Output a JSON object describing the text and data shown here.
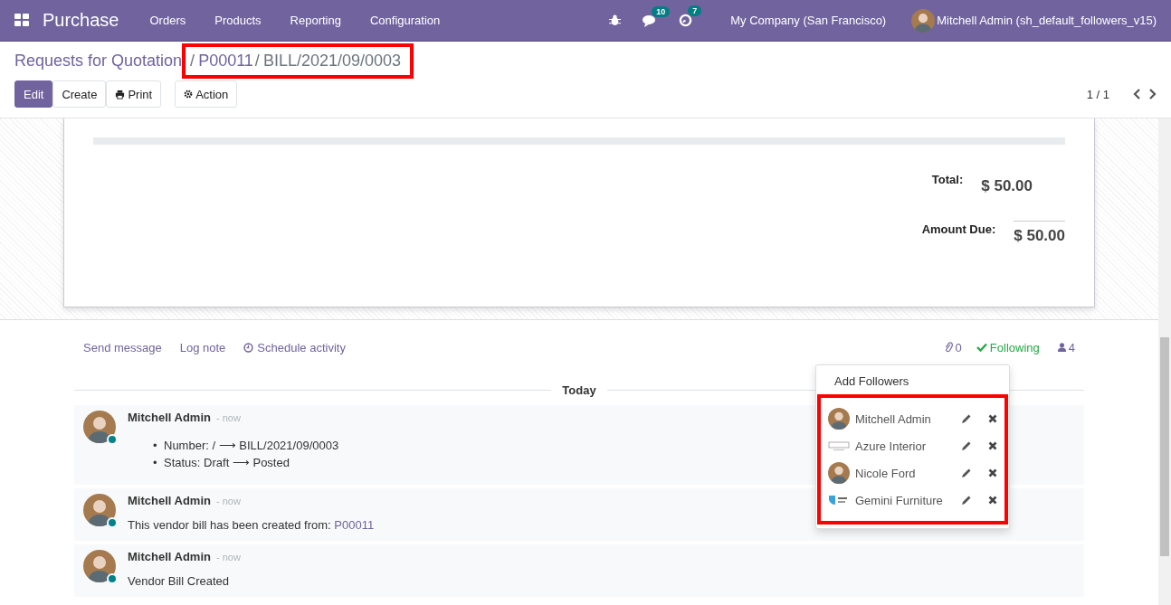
{
  "navbar": {
    "app": "Purchase",
    "menu": [
      "Orders",
      "Products",
      "Reporting",
      "Configuration"
    ],
    "messages_badge": "10",
    "activities_badge": "7",
    "company": "My Company (San Francisco)",
    "user": "Mitchell Admin (sh_default_followers_v15)"
  },
  "breadcrumb": [
    {
      "label": "Requests for Quotation",
      "kind": "link"
    },
    {
      "label": "P00011",
      "kind": "link",
      "separator": "/"
    },
    {
      "label": "BILL/2021/09/0003",
      "kind": "current",
      "separator": "/"
    }
  ],
  "buttons": [
    {
      "label": "Edit",
      "kind": "primary"
    },
    {
      "label": "Create",
      "kind": "secondary"
    },
    {
      "label": "Print",
      "kind": "print"
    },
    {
      "label": "Action",
      "kind": "action"
    }
  ],
  "pager": "1 / 1",
  "totals": [
    {
      "label": "Total:",
      "value": "$ 50.00",
      "kind": "plain"
    },
    {
      "label": "Amount Due:",
      "value": "$ 50.00",
      "kind": "ruled"
    }
  ],
  "chatter": {
    "actions": [
      {
        "label": "Send message",
        "kind": "plain"
      },
      {
        "label": "Log note",
        "kind": "plain"
      },
      {
        "label": "Schedule activity",
        "kind": "clock"
      }
    ],
    "attachments": "0",
    "following": "Following",
    "followers_count": "4",
    "day": "Today",
    "messages": [
      {
        "author": "Mitchell Admin",
        "time": "- now",
        "kind": "list",
        "items": [
          {
            "bullet": "•",
            "text": "Number: / ⟶ BILL/2021/09/0003"
          },
          {
            "bullet": "•",
            "text": "Status: Draft ⟶ Posted"
          }
        ]
      },
      {
        "author": "Mitchell Admin",
        "time": "- now",
        "kind": "link",
        "text": "This vendor bill has been created from:",
        "link": "P00011"
      },
      {
        "author": "Mitchell Admin",
        "time": "- now",
        "kind": "text",
        "text": "Vendor Bill Created"
      }
    ],
    "followers_menu": {
      "add": "Add Followers",
      "followers": [
        {
          "name": "Mitchell Admin",
          "kind": "person"
        },
        {
          "name": "Azure Interior",
          "kind": "company"
        },
        {
          "name": "Nicole Ford",
          "kind": "person"
        },
        {
          "name": "Gemini Furniture",
          "kind": "company"
        }
      ]
    }
  }
}
